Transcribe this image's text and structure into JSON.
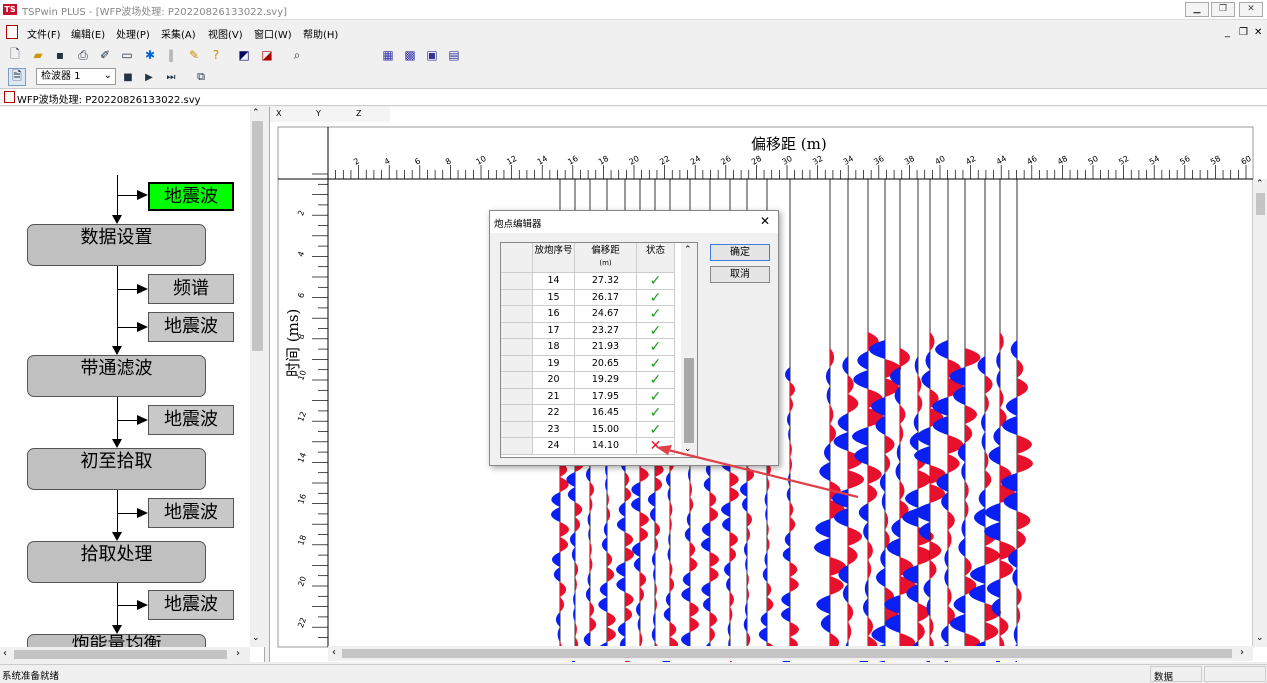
{
  "window": {
    "title": "TSPwin PLUS - [WFP波场处理: P20220826133022.svy]",
    "logo": "tsp-logo"
  },
  "menu": {
    "items": [
      "文件(F)",
      "编辑(E)",
      "处理(P)",
      "采集(A)",
      "视图(V)",
      "窗口(W)",
      "帮助(H)"
    ]
  },
  "toolbar2": {
    "detector": "检波器 1"
  },
  "doc_tab": {
    "label": "WFP波场处理: P20220826133022.svy"
  },
  "flow": {
    "top": "地震波",
    "step1": "数据设置",
    "step1_a": "频谱",
    "step1_b": "地震波",
    "step2": "带通滤波",
    "step2_a": "地震波",
    "step3": "初至拾取",
    "step3_a": "地震波",
    "step4": "拾取处理",
    "step4_a": "地震波",
    "step5": "炮能量均衡"
  },
  "axes": {
    "x_label": "偏移距 (m)",
    "y_label": "时间 (ms)",
    "tabs": [
      "X",
      "Y",
      "Z"
    ],
    "x_ticks": [
      "2",
      "4",
      "6",
      "8",
      "10",
      "12",
      "14",
      "16",
      "18",
      "20",
      "22",
      "24",
      "26",
      "28",
      "30",
      "32",
      "34",
      "36",
      "38",
      "40",
      "42",
      "44",
      "46",
      "48",
      "50",
      "52",
      "54",
      "56",
      "58",
      "60"
    ],
    "y_ticks": [
      "2",
      "4",
      "6",
      "8",
      "10",
      "12",
      "14",
      "16",
      "18",
      "20",
      "22"
    ]
  },
  "dialog": {
    "title": "炮点编辑器",
    "col_shot": "放炮序号",
    "col_offset": "偏移距",
    "col_unit": "(m)",
    "col_status": "状态",
    "ok": "确定",
    "cancel": "取消",
    "rows": [
      {
        "shot": "14",
        "offset": "27.32",
        "status": "ok"
      },
      {
        "shot": "15",
        "offset": "26.17",
        "status": "ok"
      },
      {
        "shot": "16",
        "offset": "24.67",
        "status": "ok"
      },
      {
        "shot": "17",
        "offset": "23.27",
        "status": "ok"
      },
      {
        "shot": "18",
        "offset": "21.93",
        "status": "ok"
      },
      {
        "shot": "19",
        "offset": "20.65",
        "status": "ok"
      },
      {
        "shot": "20",
        "offset": "19.29",
        "status": "ok"
      },
      {
        "shot": "21",
        "offset": "17.95",
        "status": "ok"
      },
      {
        "shot": "22",
        "offset": "16.45",
        "status": "ok"
      },
      {
        "shot": "23",
        "offset": "15.00",
        "status": "ok"
      },
      {
        "shot": "24",
        "offset": "14.10",
        "status": "bad"
      }
    ]
  },
  "status": {
    "left": "系统准备就绪",
    "right": "数据"
  },
  "colors": {
    "positive": "#e8112d",
    "negative": "#0a1ff2",
    "highlight": "#00ff00",
    "arrow": "#e0404a",
    "check": "#1a9a1a"
  }
}
